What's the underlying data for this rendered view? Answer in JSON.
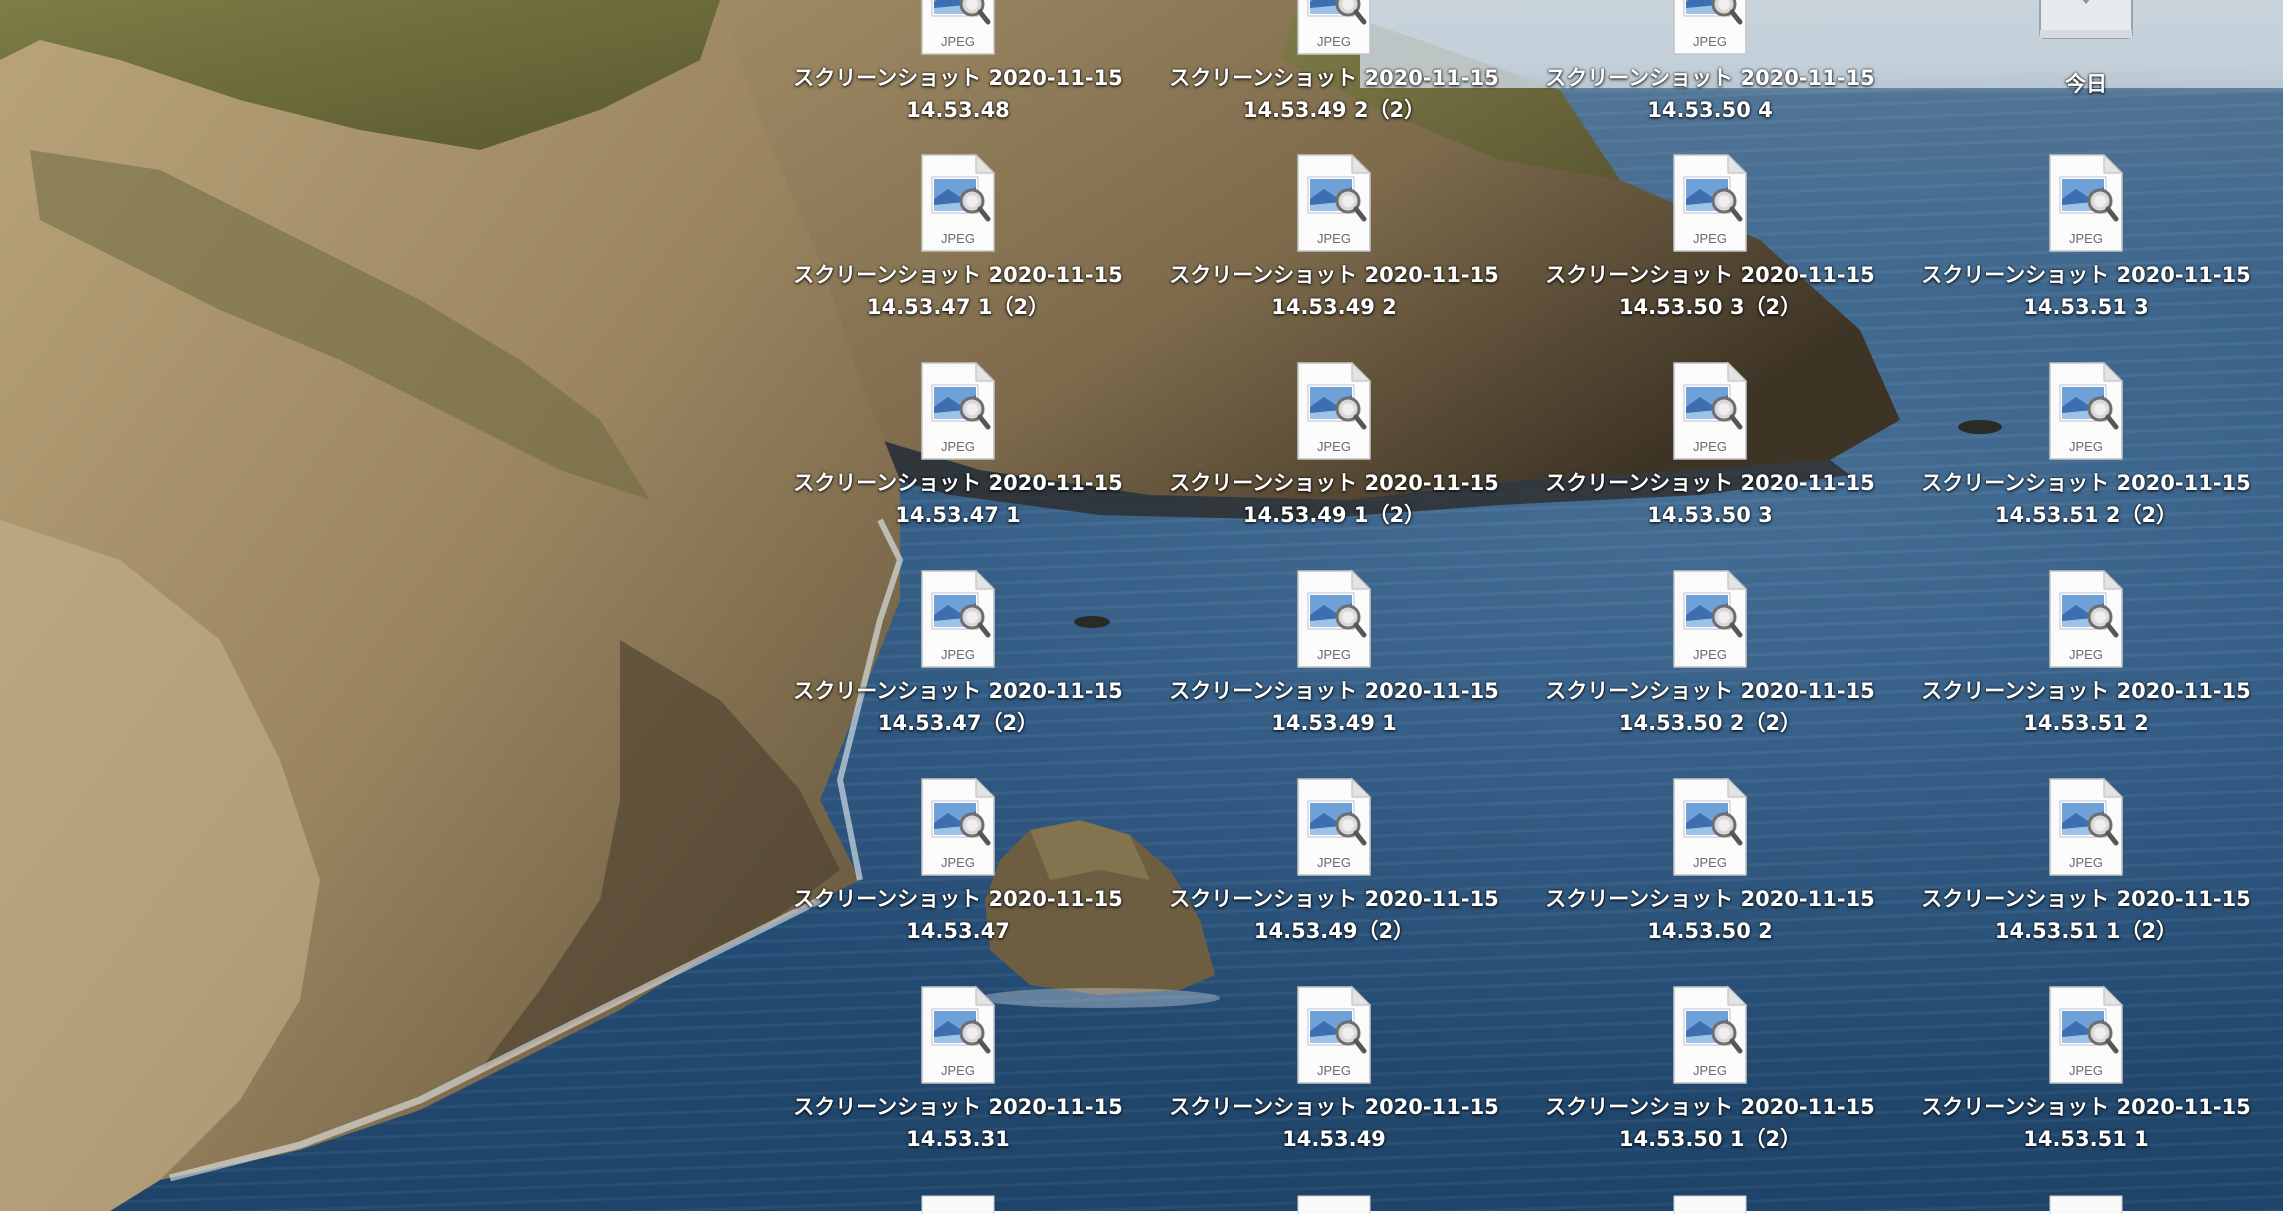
{
  "desktop": {
    "file_type_label": "JPEG",
    "folder_label": "今日",
    "columns": [
      {
        "items": [
          {
            "name_line1": "スクリーンショット 2020-11-15",
            "name_line2": "14.53.48"
          },
          {
            "name_line1": "スクリーンショット 2020-11-15",
            "name_line2": "14.53.47 1（2）"
          },
          {
            "name_line1": "スクリーンショット 2020-11-15",
            "name_line2": "14.53.47 1"
          },
          {
            "name_line1": "スクリーンショット 2020-11-15",
            "name_line2": "14.53.47（2）"
          },
          {
            "name_line1": "スクリーンショット 2020-11-15",
            "name_line2": "14.53.47"
          },
          {
            "name_line1": "スクリーンショット 2020-11-15",
            "name_line2": "14.53.31"
          }
        ]
      },
      {
        "items": [
          {
            "name_line1": "スクリーンショット 2020-11-15",
            "name_line2": "14.53.49 2（2）"
          },
          {
            "name_line1": "スクリーンショット 2020-11-15",
            "name_line2": "14.53.49 2"
          },
          {
            "name_line1": "スクリーンショット 2020-11-15",
            "name_line2": "14.53.49 1（2）"
          },
          {
            "name_line1": "スクリーンショット 2020-11-15",
            "name_line2": "14.53.49 1"
          },
          {
            "name_line1": "スクリーンショット 2020-11-15",
            "name_line2": "14.53.49（2）"
          },
          {
            "name_line1": "スクリーンショット 2020-11-15",
            "name_line2": "14.53.49"
          }
        ]
      },
      {
        "items": [
          {
            "name_line1": "スクリーンショット 2020-11-15",
            "name_line2": "14.53.50 4"
          },
          {
            "name_line1": "スクリーンショット 2020-11-15",
            "name_line2": "14.53.50 3（2）"
          },
          {
            "name_line1": "スクリーンショット 2020-11-15",
            "name_line2": "14.53.50 3"
          },
          {
            "name_line1": "スクリーンショット 2020-11-15",
            "name_line2": "14.53.50 2（2）"
          },
          {
            "name_line1": "スクリーンショット 2020-11-15",
            "name_line2": "14.53.50 2"
          },
          {
            "name_line1": "スクリーンショット 2020-11-15",
            "name_line2": "14.53.50 1（2）"
          }
        ]
      },
      {
        "items": [
          {
            "name_line1": "スクリーンショット 2020-11-15",
            "name_line2": "14.53.51 3"
          },
          {
            "name_line1": "スクリーンショット 2020-11-15",
            "name_line2": "14.53.51 2（2）"
          },
          {
            "name_line1": "スクリーンショット 2020-11-15",
            "name_line2": "14.53.51 2"
          },
          {
            "name_line1": "スクリーンショット 2020-11-15",
            "name_line2": "14.53.51 1（2）"
          },
          {
            "name_line1": "スクリーンショット 2020-11-15",
            "name_line2": "14.53.51 1"
          }
        ]
      }
    ]
  }
}
